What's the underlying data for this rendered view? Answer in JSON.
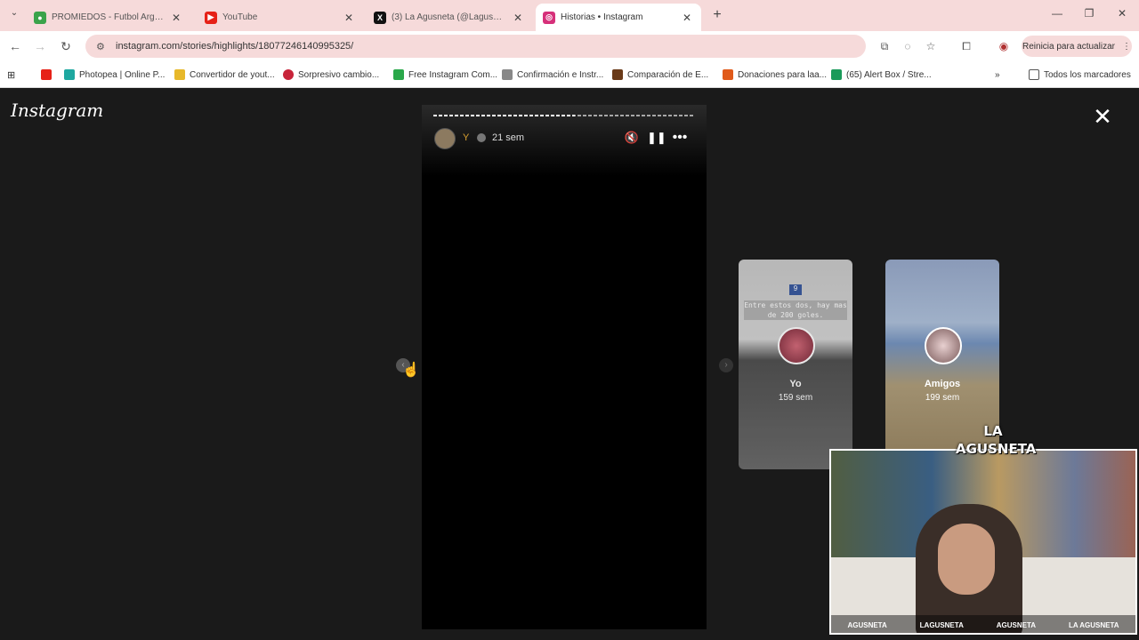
{
  "browser": {
    "tabs": [
      {
        "title": "PROMIEDOS - Futbol Argentino",
        "favicon_color": "#3aa34a",
        "active": false
      },
      {
        "title": "YouTube",
        "favicon_color": "#e62117",
        "active": false
      },
      {
        "title": "(3) La Agusneta (@Lagusneta) / X",
        "favicon_color": "#111111",
        "active": false
      },
      {
        "title": "Historias • Instagram",
        "favicon_color": "#d6307a",
        "active": true
      }
    ],
    "address": "instagram.com/stories/highlights/18077246140995325/",
    "relaunch_label": "Reinicia para actualizar",
    "bookmarks": [
      {
        "label": "",
        "icon_color": "#e62117"
      },
      {
        "label": "Photopea | Online P...",
        "icon_color": "#1ea8a0"
      },
      {
        "label": "Convertidor de yout...",
        "icon_color": "#e7b82a"
      },
      {
        "label": "Sorpresivo cambio...",
        "icon_color": "#c8243a"
      },
      {
        "label": "Free Instagram Com...",
        "icon_color": "#2aa84a"
      },
      {
        "label": "Confirmación e Instr...",
        "icon_color": "#888888"
      },
      {
        "label": "Comparación de E...",
        "icon_color": "#6a3a18"
      },
      {
        "label": "Donaciones para laa...",
        "icon_color": "#e05a1a"
      },
      {
        "label": "(65) Alert Box / Stre...",
        "icon_color": "#1a9a5a"
      }
    ],
    "all_bookmarks_label": "Todos los marcadores"
  },
  "instagram": {
    "logo": "Instagram",
    "story": {
      "time": "21 sem",
      "progress": 0.54
    },
    "previews": [
      {
        "number": "9",
        "caption": "Entre estos dos, hay mas de 200 goles.",
        "name": "Yo",
        "time": "159 sem"
      },
      {
        "name": "Amigos",
        "time": "199 sem"
      }
    ]
  },
  "webcam": {
    "logo": "LA AGUSNETA",
    "socials": [
      "AGUSNETA",
      "LAGUSNETA",
      "AGUSNETA",
      "LA AGUSNETA"
    ]
  }
}
